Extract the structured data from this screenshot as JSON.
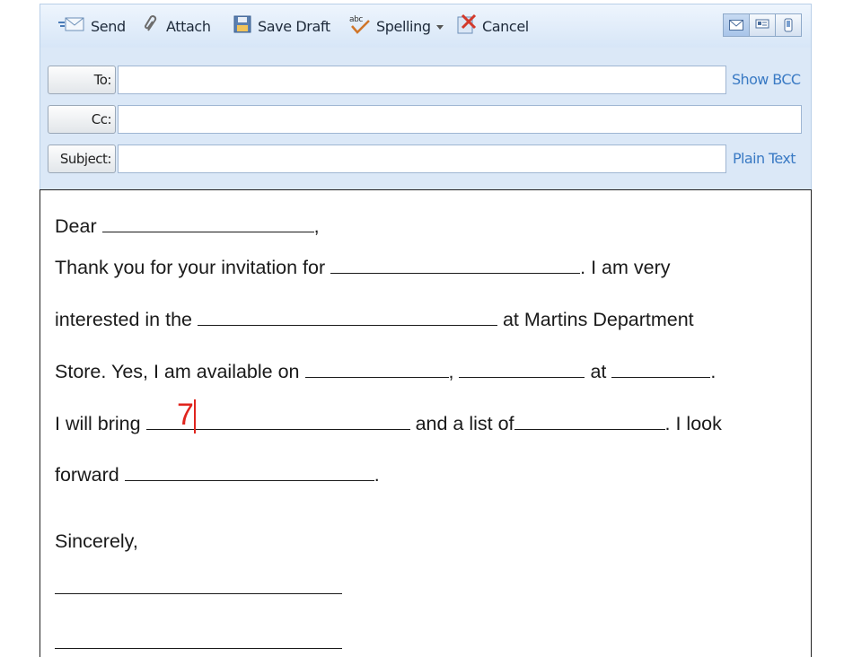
{
  "toolbar": {
    "send": "Send",
    "attach": "Attach",
    "save_draft": "Save Draft",
    "spelling": "Spelling",
    "cancel": "Cancel"
  },
  "header": {
    "to_label": "To:",
    "cc_label": "Cc:",
    "subject_label": "Subject:",
    "show_bcc": "Show BCC",
    "plain_text": "Plain Text",
    "to_value": "",
    "cc_value": "",
    "subject_value": ""
  },
  "letter": {
    "l1_a": "Dear",
    "l1_b": ",",
    "l2_a": "Thank you for your invitation for",
    "l2_b": ". I am very",
    "l3_a": "interested in the",
    "l3_b": "at Martins Department",
    "l4_a": "Store.   Yes, I am available on",
    "l4_b": ",",
    "l4_c": "at",
    "l4_d": ".",
    "l5_a": "I will bring",
    "l5_b": "and a list of",
    "l5_c": ".  I look",
    "l6_a": "forward",
    "l6_b": ".",
    "closing": "Sincerely,"
  },
  "annotation": {
    "marker": "7"
  },
  "colors": {
    "toolbar_bg": "#d7e6f7",
    "link": "#3a7ac4",
    "marker": "#e0251e"
  },
  "icons": [
    "send-icon",
    "paperclip-icon",
    "save-icon",
    "spellcheck-icon",
    "cancel-icon",
    "mail-view-icon",
    "card-view-icon",
    "phone-view-icon"
  ]
}
